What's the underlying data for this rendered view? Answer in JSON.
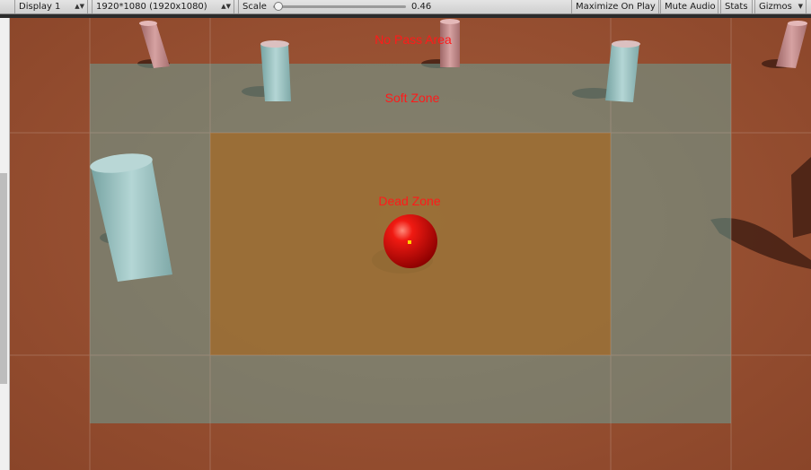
{
  "toolbar": {
    "display": "Display 1",
    "resolution": "1920*1080 (1920x1080)",
    "scale_label": "Scale",
    "scale_value": "0.46",
    "scale_slider_fraction": 0.01,
    "maximize_on_play": "Maximize On Play",
    "mute_audio": "Mute Audio",
    "stats": "Stats",
    "gizmos": "Gizmos"
  },
  "icons": {
    "dropdown": "chevron-down-icon",
    "marker": "yellow-dot"
  },
  "zones": {
    "no_pass": "No Pass Area",
    "soft": "Soft Zone",
    "dead": "Dead Zone"
  },
  "colors": {
    "ground": "#964f31",
    "soft_zone": "#6b9f96",
    "dead_zone": "#a06a2a",
    "label": "#ff1a1a",
    "ball": "#e01010",
    "pillar_pink": "#c48a8a",
    "pillar_teal": "#8fb9b8"
  }
}
